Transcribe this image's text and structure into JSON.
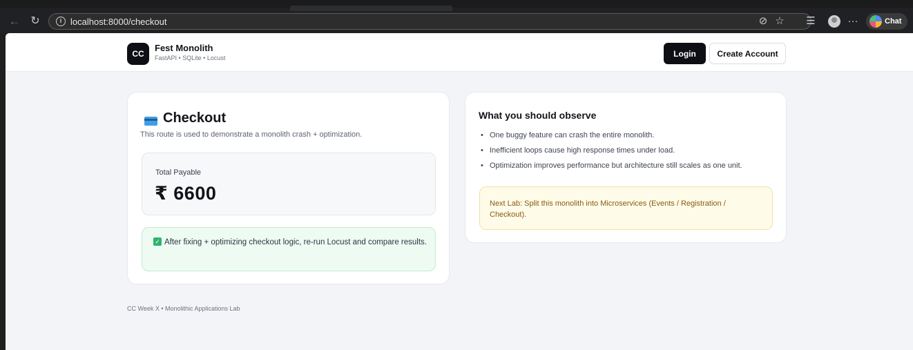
{
  "browser": {
    "url": "localhost:8000/checkout",
    "chat_label": "Chat"
  },
  "header": {
    "logo_text": "CC",
    "brand_title": "Fest Monolith",
    "brand_subtitle": "FastAPI • SQLite • Locust",
    "login_label": "Login",
    "create_account_label": "Create Account"
  },
  "checkout": {
    "title": "Checkout",
    "description": "This route is used to demonstrate a monolith crash + optimization.",
    "total_label": "Total Payable",
    "total_amount": "₹ 6600",
    "success_message": "After fixing + optimizing checkout logic, re-run Locust and compare results."
  },
  "observe": {
    "title": "What you should observe",
    "items": [
      "One buggy feature can crash the entire monolith.",
      "Inefficient loops cause high response times under load.",
      "Optimization improves performance but architecture still scales as one unit."
    ],
    "next_lab": "Next Lab: Split this monolith into Microservices (Events / Registration / Checkout)."
  },
  "footer": {
    "text": "CC Week X • Monolithic Applications Lab"
  },
  "colors": {
    "accent_dark": "#0d0f14",
    "success_bg": "#eefbf3",
    "warning_bg": "#fefbe9",
    "warning_text": "#8a5a0f"
  }
}
